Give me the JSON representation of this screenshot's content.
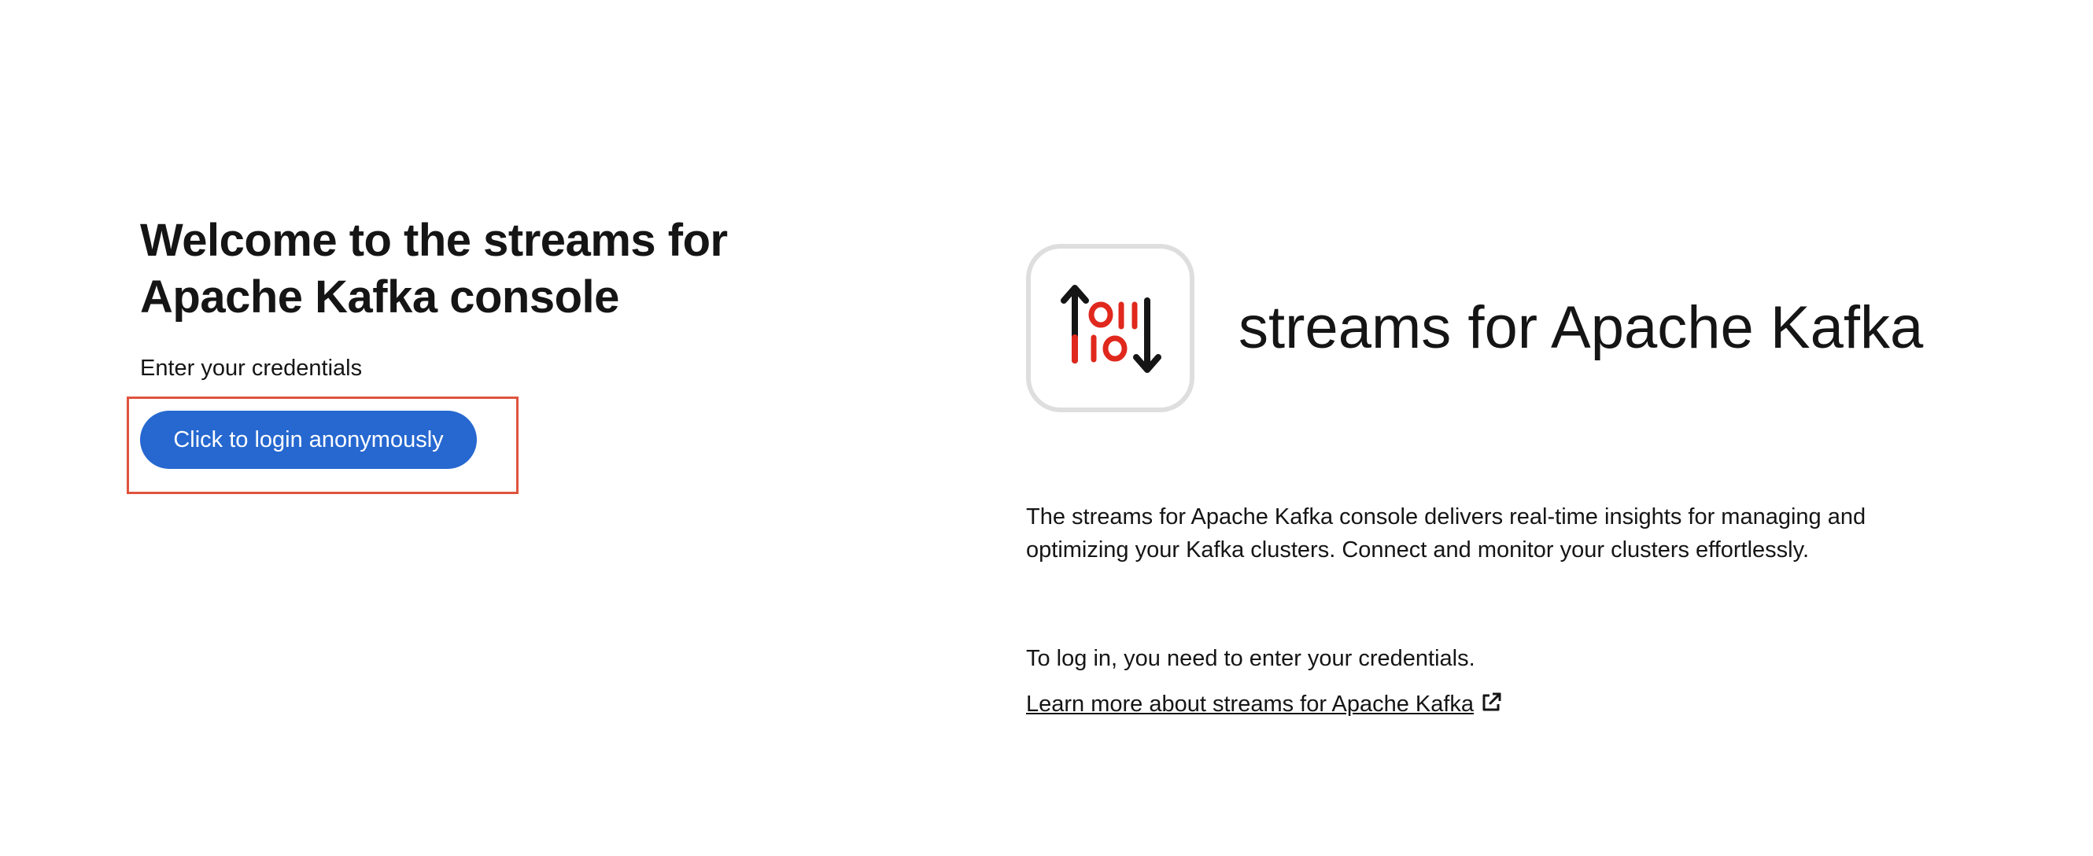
{
  "login": {
    "title_line1": "Welcome to the streams for",
    "title_line2": "Apache Kafka console",
    "subtitle": "Enter your credentials",
    "button_label": "Click to login anonymously"
  },
  "brand": {
    "logo_icon": "streams-kafka-logo-icon",
    "name": "streams for Apache Kafka",
    "description": "The streams for Apache Kafka console delivers real-time insights for managing and optimizing your Kafka clusters. Connect and monitor your clusters effortlessly.",
    "login_hint": "To log in, you need to enter your credentials.",
    "learn_more_label": "Learn more about streams for Apache Kafka",
    "learn_more_icon": "external-link-icon"
  },
  "colors": {
    "primary_button": "#2668d0",
    "highlight_border": "#e0533d",
    "logo_red": "#e0281d",
    "logo_border": "#dedede",
    "text": "#151515"
  }
}
